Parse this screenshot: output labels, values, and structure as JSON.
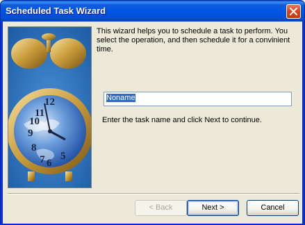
{
  "window": {
    "title": "Scheduled Task Wizard"
  },
  "titlebar": {
    "close_icon": "close-icon"
  },
  "image": {
    "icon": "alarm-clock-globe-image"
  },
  "content": {
    "description": "This wizard helps you to schedule a task to perform. You select the operation, and then schedule it for a convinient time.",
    "task_name_value": "Noname",
    "instruction": "Enter the task name and click Next to continue."
  },
  "buttons": {
    "back_label": "< Back",
    "next_label": "Next >",
    "cancel_label": "Cancel"
  },
  "colors": {
    "title_blue": "#0055e5",
    "close_red": "#d5451c",
    "dialog_bg": "#ECE9D8",
    "selection": "#316ac5"
  }
}
